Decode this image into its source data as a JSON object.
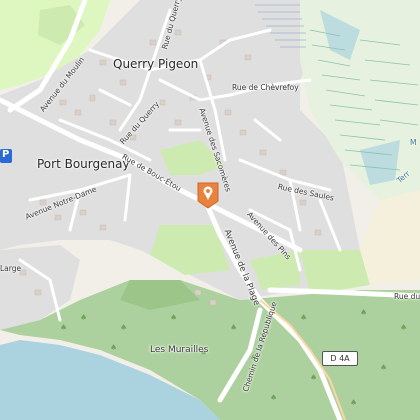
{
  "map": {
    "colors": {
      "land": "#f2efe9",
      "residential": "#e0dfdf",
      "forest": "#add19e",
      "forest_dark": "#9cc58a",
      "grass": "#cdebb0",
      "golf": "#def6c0",
      "meadow": "#b8e5a8",
      "water": "#aad3df",
      "road": "#ffffff",
      "main_road": "#fcd6a4",
      "marker": "#e8823d",
      "building": "#d9d0c9"
    },
    "places": {
      "querry_pigeon": "Querry Pigeon",
      "port_bourgenay": "Port Bourgenay",
      "les_murailles": "Les Murailles"
    },
    "streets": {
      "avenue_du_moulin": "Avenue du Moulin",
      "rue_du_querry_top": "Rue du Querry",
      "rue_de_chevrefoy": "Rue de Chèvrefoy",
      "rue_du_querry": "Rue du Querry",
      "rue_de_bouc_etou": "Rue de Bouc-Étou",
      "avenue_des_sacomeres": "Avenue des Sacomères",
      "avenue_notre_dame": "Avenue Notre-Dame",
      "rue_des_saules": "Rue des Saules",
      "avenue_des_pins": "Avenue des Pins",
      "avenue_de_la_plage": "Avenue de la Plage",
      "rue_du_right": "Rue du",
      "chemin_de_la_republique": "Chemin de la République",
      "large_fragment": "Large",
      "terre_fragment": "Terr",
      "m_fragment": "M"
    },
    "road_ref": "D 4A",
    "parking_symbol": "P",
    "marker_icon": "map-marker-icon"
  }
}
